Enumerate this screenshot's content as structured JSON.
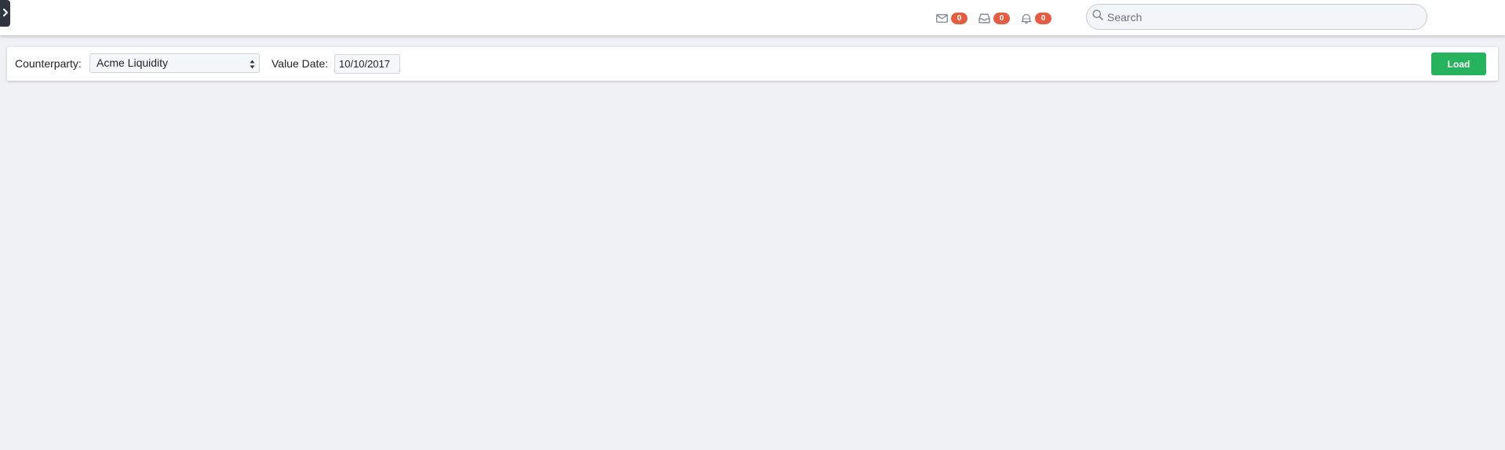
{
  "header": {
    "notifications": [
      {
        "icon": "mail-icon",
        "count": "0"
      },
      {
        "icon": "inbox-icon",
        "count": "0"
      },
      {
        "icon": "bell-icon",
        "count": "0"
      }
    ],
    "search": {
      "placeholder": "Search",
      "value": ""
    }
  },
  "filters": {
    "counterparty_label": "Counterparty:",
    "counterparty_selected": "Acme Liquidity",
    "value_date_label": "Value Date:",
    "value_date": "10/10/2017",
    "load_label": "Load"
  },
  "colors": {
    "badge": "#e35d43",
    "load_button": "#27b35e",
    "background": "#f0f1f5",
    "sidebar_toggle": "#2f3640"
  }
}
